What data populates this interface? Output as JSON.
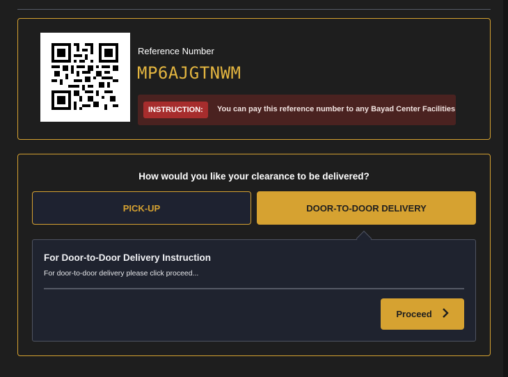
{
  "reference": {
    "label": "Reference Number",
    "number": "MP6AJGTNWM",
    "instruction_tag": "INSTRUCTION:",
    "instruction_text": "You can pay this reference number to any Bayad Center Facilities"
  },
  "delivery": {
    "question": "How would you like your clearance to be delivered?",
    "options": [
      "PICK-UP",
      "DOOR-TO-DOOR DELIVERY"
    ],
    "selected": "DOOR-TO-DOOR DELIVERY",
    "panel": {
      "title": "For Door-to-Door Delivery Instruction",
      "text": "For door-to-door delivery please click proceed...",
      "proceed_label": "Proceed",
      "proceed_icon": "chevron-right-icon"
    }
  },
  "colors": {
    "accent": "#d6a231",
    "reference_number": "#e3b540",
    "instruction_bg": "#4a2220",
    "instruction_tag_bg": "#a72d2d",
    "background": "#1e1e1e",
    "panel_bg": "#1f232f"
  }
}
